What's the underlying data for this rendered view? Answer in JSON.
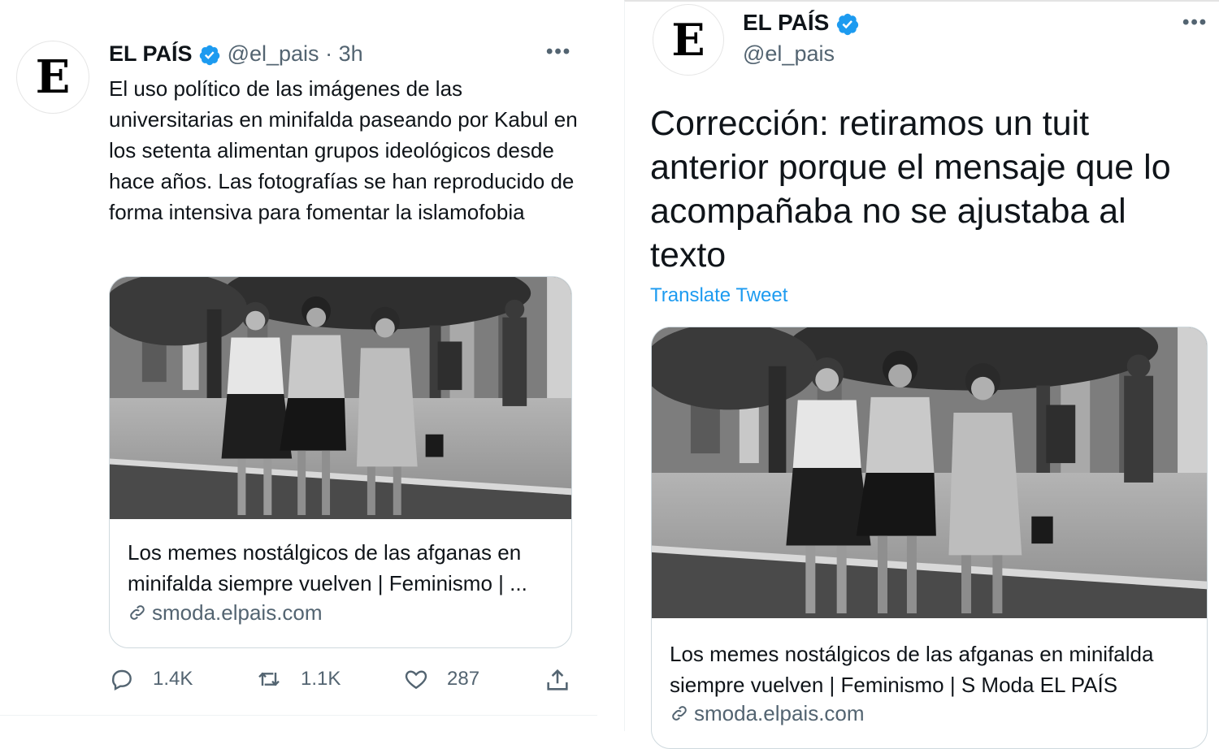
{
  "left_tweet": {
    "avatar_letter": "E",
    "name": "EL PAÍS",
    "handle": "@el_pais",
    "separator": "·",
    "time": "3h",
    "more_icon": "more-horizontal-icon",
    "text": "El uso político de las imágenes de las universitarias en minifalda paseando por Kabul en los setenta alimentan grupos ideológicos desde hace años. Las fotografías se han reproducido de forma intensiva para fomentar la islamofobia",
    "card": {
      "title": "Los memes nostálgicos de las afganas en minifalda siempre vuelven | Feminismo | ...",
      "domain": "smoda.elpais.com",
      "photo_desc": "black-and-white street photo"
    },
    "actions": {
      "reply_count": "1.4K",
      "retweet_count": "1.1K",
      "like_count": "287"
    }
  },
  "right_tweet": {
    "avatar_letter": "E",
    "name": "EL PAÍS",
    "handle": "@el_pais",
    "text": "Corrección: retiramos un tuit anterior porque el mensaje que lo acompañaba no se ajustaba al texto",
    "translate_label": "Translate Tweet",
    "card": {
      "title": "Los memes nostálgicos de las afganas en minifalda siempre vuelven | Feminismo | S Moda EL PAÍS",
      "domain": "smoda.elpais.com"
    }
  },
  "colors": {
    "verified_blue": "#1d9bf0",
    "text": "#0f1419",
    "muted": "#536471",
    "border": "#cfd9de"
  }
}
